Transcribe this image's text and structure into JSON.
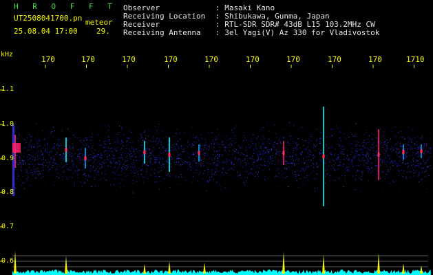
{
  "header": {
    "software": "H R O F F T",
    "filename": "UT2508041700.pn",
    "tag": "meteor",
    "datetime": "25.08.04 17:00",
    "count": "29.",
    "fields": [
      {
        "label": "Observer",
        "value": ": Masaki Kano"
      },
      {
        "label": "Receiving Location",
        "value": ": Shibukawa, Gunma, Japan"
      },
      {
        "label": "Receiver",
        "value": ": RTL-SDR SDR# 43dB L15 103.2MHz CW"
      },
      {
        "label": "Receiving Antenna",
        "value": ": 3el Yagi(V) Az 330 for Vladivostok"
      }
    ]
  },
  "axis": {
    "unit": "kHz",
    "x_ticks": [
      "170",
      "170",
      "170",
      "170",
      "170",
      "170",
      "170",
      "170",
      "170",
      "1710"
    ],
    "y_ticks": [
      "1.1",
      "1.0",
      "0.9",
      "0.8",
      "0.7",
      "0.6"
    ]
  },
  "colors": {
    "background": "#000000",
    "header_text": "#e6e6e6",
    "title_green": "#3fe03f",
    "axis_yellow": "#f4f400",
    "noise_blue": "#2a2aff",
    "echo_cyan": "#00ffff",
    "echo_magenta": "#ff2070"
  }
}
